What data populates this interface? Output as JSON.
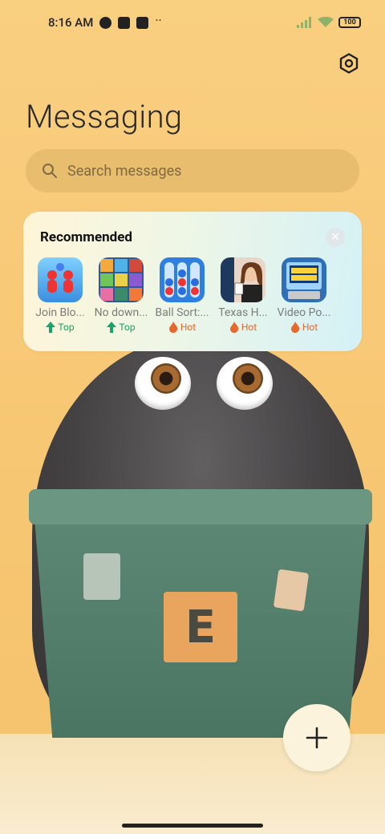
{
  "status_bar": {
    "time": "8:16 AM",
    "battery": "100"
  },
  "header": {
    "title": "Messaging",
    "settings_icon": "gear-hex-icon"
  },
  "search": {
    "placeholder": "Search messages"
  },
  "recommended": {
    "title": "Recommended",
    "apps": [
      {
        "name": "Join Blo...",
        "badge": "Top",
        "badge_type": "top"
      },
      {
        "name": "No down...",
        "badge": "Top",
        "badge_type": "top"
      },
      {
        "name": "Ball Sort:...",
        "badge": "Hot",
        "badge_type": "hot"
      },
      {
        "name": "Texas H...",
        "badge": "Hot",
        "badge_type": "hot"
      },
      {
        "name": "Video Po...",
        "badge": "Hot",
        "badge_type": "hot"
      }
    ]
  },
  "wallpaper": {
    "bin_label": "E"
  },
  "colors": {
    "background": "#f8c979",
    "search_bg": "#e8be6e",
    "top_badge": "#1aa46b",
    "hot_badge": "#e8672a"
  }
}
